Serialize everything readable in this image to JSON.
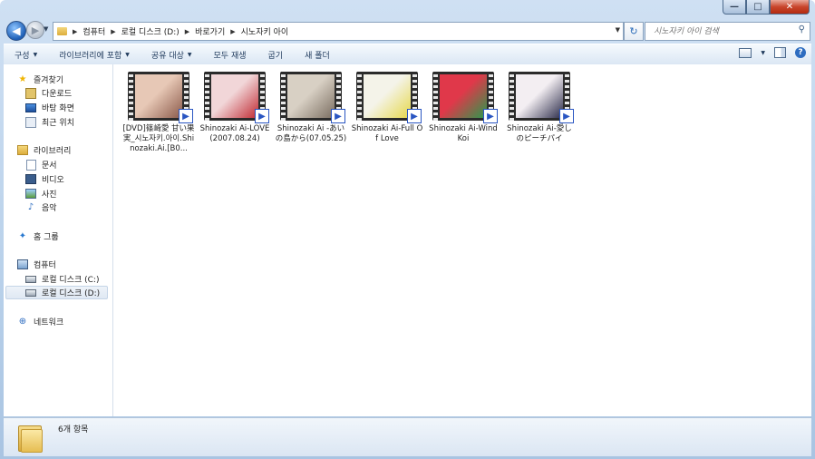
{
  "window": {
    "buttons": {
      "minimize": "—",
      "maximize": "□",
      "close": "✕"
    }
  },
  "nav": {
    "back_glyph": "◀",
    "forward_glyph": "▶",
    "breadcrumbs": [
      "컴퓨터",
      "로컬 디스크 (D:)",
      "바로가기",
      "시노자키 아이"
    ],
    "refresh_glyph": "↻",
    "search_placeholder": "시노자키 아이 검색"
  },
  "toolbar": {
    "items": [
      "구성",
      "라이브러리에 포함",
      "공유 대상",
      "모두 재생",
      "굽기",
      "새 폴더"
    ]
  },
  "sidebar": {
    "favorites": {
      "header": "즐겨찾기",
      "items": [
        "다운로드",
        "바탕 화면",
        "최근 위치"
      ]
    },
    "libraries": {
      "header": "라이브러리",
      "items": [
        "문서",
        "비디오",
        "사진",
        "음악"
      ]
    },
    "homegroup": "홈 그룹",
    "computer": {
      "header": "컴퓨터",
      "items": [
        "로컬 디스크 (C:)",
        "로컬 디스크 (D:)"
      ]
    },
    "network": "네트워크"
  },
  "files": [
    {
      "name": "[DVD]篠崎愛 甘い果実_시노자키.아이.Shinozaki.Ai.[B0...",
      "colors": [
        "#e7c8b6",
        "#8b5a4a"
      ]
    },
    {
      "name": "Shinozaki Ai-LOVE(2007.08.24)",
      "colors": [
        "#f1d6d8",
        "#c02a32"
      ]
    },
    {
      "name": "Shinozaki Ai -あいの島から(07.05.25)",
      "colors": [
        "#d8d0c4",
        "#7a6d60"
      ]
    },
    {
      "name": "Shinozaki Ai-Full Of Love",
      "colors": [
        "#f4f3e9",
        "#e6d84a"
      ]
    },
    {
      "name": "Shinozaki Ai-Wind Koi",
      "colors": [
        "#e0384a",
        "#2a9a4c"
      ]
    },
    {
      "name": "Shinozaki Ai-愛しのピーチパイ",
      "colors": [
        "#f3eef2",
        "#2a2a48"
      ]
    }
  ],
  "status": {
    "count": "6개 항목"
  }
}
